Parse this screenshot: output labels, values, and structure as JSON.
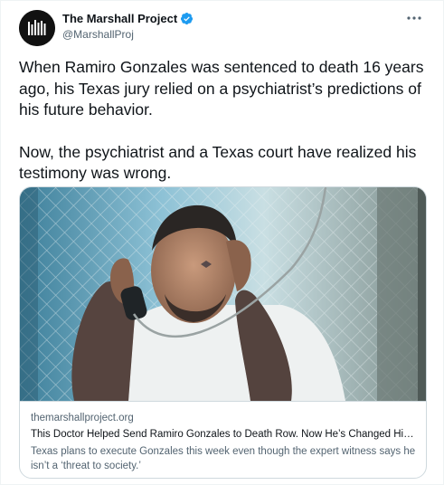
{
  "tweet": {
    "author": {
      "display_name": "The Marshall Project",
      "handle": "@MarshallProj",
      "verified": true,
      "avatar_icon": "marshall-project-logo",
      "verified_icon": "verified-badge-icon"
    },
    "more_icon": "more-options-icon",
    "paragraphs": [
      "When Ramiro Gonzales was sentenced to death 16 years ago, his Texas jury relied on a psychiatrist’s predictions of his future behavior.",
      "Now, the psychiatrist and a Texas court have realized his testimony was wrong."
    ],
    "link_card": {
      "domain": "themarshallproject.org",
      "title": "This Doctor Helped Send Ramiro Gonzales to Death Row. Now He’s Changed His Mind.",
      "description": "Texas plans to execute Gonzales this week even though the expert witness says he isn’t a ‘threat to society.’"
    }
  },
  "colors": {
    "text_primary": "#0f1419",
    "text_secondary": "#536471",
    "verified_blue": "#1d9bf0",
    "border": "#cfd9de"
  }
}
